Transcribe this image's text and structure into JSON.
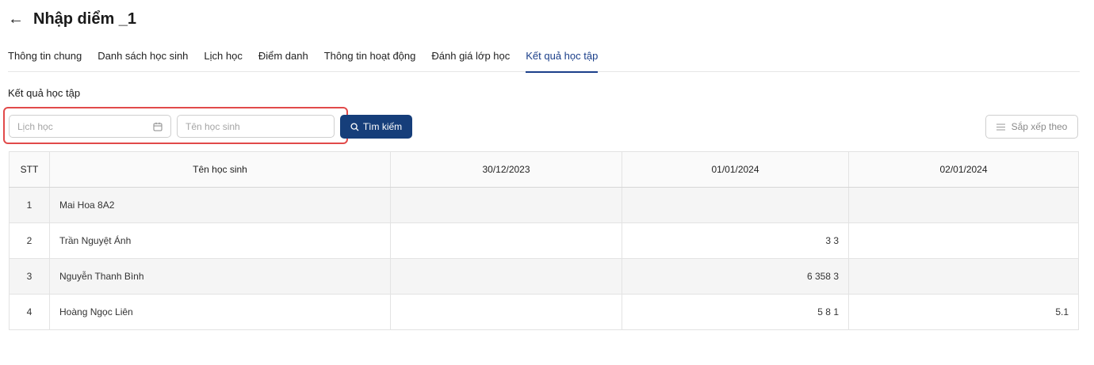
{
  "header": {
    "back_icon": "arrow-left-icon",
    "title": "Nhập diểm _1"
  },
  "tabs": [
    {
      "label": "Thông tin chung",
      "active": false
    },
    {
      "label": "Danh sách học sinh",
      "active": false
    },
    {
      "label": "Lịch học",
      "active": false
    },
    {
      "label": "Điểm danh",
      "active": false
    },
    {
      "label": "Thông tin hoạt động",
      "active": false
    },
    {
      "label": "Đánh giá lớp học",
      "active": false
    },
    {
      "label": "Kết quả học tập",
      "active": true
    }
  ],
  "section": {
    "title": "Kết quả học tập"
  },
  "filters": {
    "schedule": {
      "placeholder": "Lịch học",
      "value": "",
      "icon": "calendar-icon"
    },
    "student_name": {
      "placeholder": "Tên học sinh",
      "value": ""
    }
  },
  "search_button": {
    "label": "Tìm kiếm",
    "icon": "search-icon"
  },
  "sort_button": {
    "label": "Sắp xếp theo",
    "icon": "sort-lines-icon"
  },
  "table": {
    "columns": [
      "STT",
      "Tên học sinh",
      "30/12/2023",
      "01/01/2024",
      "02/01/2024"
    ],
    "rows": [
      [
        "1",
        "Mai Hoa 8A2",
        "",
        "",
        ""
      ],
      [
        "2",
        "Trần Nguyệt Ánh",
        "",
        "3 3",
        ""
      ],
      [
        "3",
        "Nguyễn Thanh Bình",
        "",
        "6 358 3",
        ""
      ],
      [
        "4",
        "Hoàng Ngọc Liên",
        "",
        "5 8 1",
        "5.1"
      ]
    ]
  },
  "colors": {
    "accent": "#163e7a",
    "active_tab": "#1b3f8a",
    "highlight": "#e14a4a",
    "row_stripe": "#f5f5f5"
  }
}
